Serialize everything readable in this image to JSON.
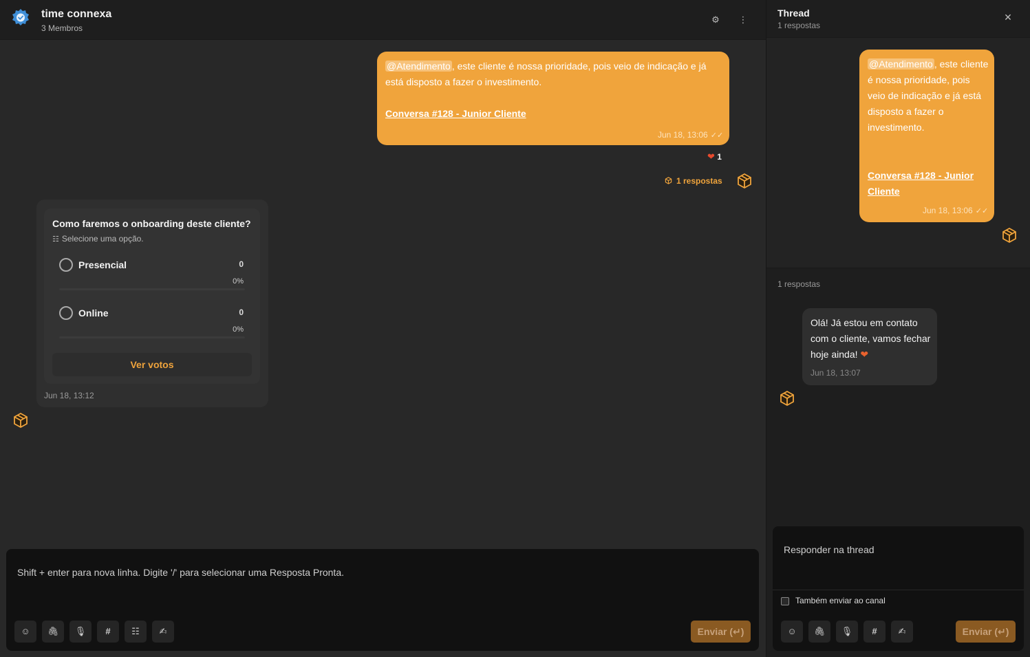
{
  "header": {
    "title": "time connexa",
    "subtitle": "3 Membros",
    "settings_icon": "gear-icon",
    "more_icon": "vertical-dots-icon"
  },
  "messages": {
    "first": {
      "mention": "@Atendimento",
      "text": ", este cliente é nossa prioridade, pois veio de indicação e já está disposto a fazer o investimento.",
      "link": "Conversa #128 - Junior Cliente",
      "time": "Jun 18, 13:06",
      "reaction_count": "1",
      "replies_label": "1 respostas"
    },
    "poll": {
      "question": "Como faremos o onboarding deste cliente?",
      "hint": "Selecione uma opção.",
      "options": [
        {
          "label": "Presencial",
          "count": "0",
          "pct": "0%",
          "fraction": 0
        },
        {
          "label": "Online",
          "count": "0",
          "pct": "0%",
          "fraction": 0
        }
      ],
      "button": "Ver votos",
      "time": "Jun 18, 13:12"
    }
  },
  "composer": {
    "placeholder": "Shift + enter para nova linha. Digite '/' para selecionar uma Resposta Pronta.",
    "send_label": "Enviar (↵)"
  },
  "thread": {
    "title": "Thread",
    "subtitle": "1 respostas",
    "parent": {
      "mention": "@Atendimento",
      "text": ", este cliente é nossa prioridade, pois veio de indicação e já está disposto a fazer o investimento.",
      "link": "Conversa #128 - Junior Cliente",
      "time": "Jun 18, 13:06"
    },
    "replies_label": "1 respostas",
    "reply": {
      "text": "Olá! Já estou em contato com o cliente, vamos fechar hoje ainda!",
      "time": "Jun 18, 13:07"
    },
    "composer": {
      "placeholder": "Responder na thread",
      "also_send_label": "Também enviar ao canal",
      "send_label": "Enviar (↵)"
    }
  },
  "colors": {
    "accent": "#f0a43c",
    "background": "#282828",
    "header": "#1e1e1e"
  }
}
